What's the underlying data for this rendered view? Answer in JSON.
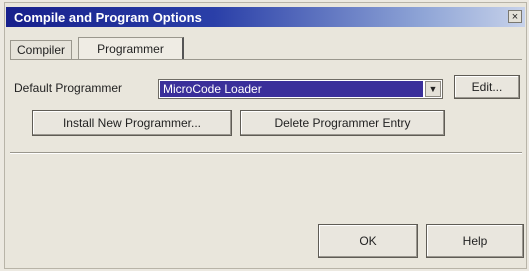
{
  "window": {
    "title": "Compile and Program Options",
    "close_glyph": "×"
  },
  "tabs": [
    {
      "label": "Compiler",
      "selected": false
    },
    {
      "label": "Programmer",
      "selected": true
    }
  ],
  "programmer": {
    "default_label": "Default Programmer",
    "selected_value": "MicroCode Loader",
    "dropdown_icon": "chevron-down-icon",
    "edit_label": "Edit...",
    "install_label": "Install New Programmer...",
    "delete_label": "Delete Programmer Entry"
  },
  "footer": {
    "ok_label": "OK",
    "help_label": "Help"
  },
  "colors": {
    "titlebar_start": "#17208c",
    "titlebar_end": "#c7d2ea",
    "selection": "#3a2f9a"
  }
}
